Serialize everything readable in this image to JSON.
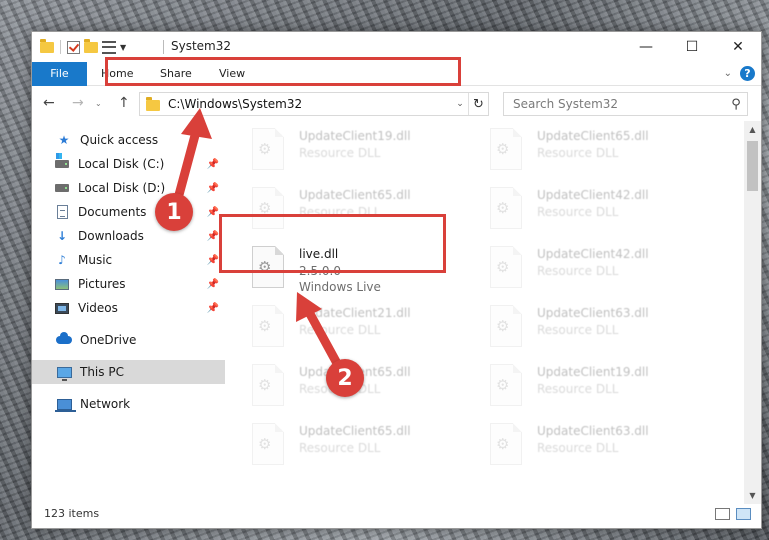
{
  "window": {
    "title": "System32",
    "controls": {
      "minimize": "—",
      "maximize": "☐",
      "close": "✕"
    }
  },
  "ribbon": {
    "tabs": [
      "File",
      "Home",
      "Share",
      "View"
    ],
    "collapse_glyph": "⌄",
    "help_glyph": "?"
  },
  "address_bar": {
    "path": "C:\\Windows\\System32",
    "dropdown_glyph": "⌄",
    "refresh_glyph": "↻"
  },
  "search": {
    "placeholder": "Search System32",
    "icon_glyph": "⚲"
  },
  "nav_buttons": {
    "back": "←",
    "forward": "→",
    "recent": "⌄",
    "up": "↑"
  },
  "sidebar": {
    "items": [
      {
        "label": "Quick access",
        "icon": "star-icon",
        "pinned": false
      },
      {
        "label": "Local Disk (C:)",
        "icon": "drive-icon",
        "pinned": true
      },
      {
        "label": "Local Disk (D:)",
        "icon": "drive-icon",
        "pinned": true
      },
      {
        "label": "Documents",
        "icon": "documents-icon",
        "pinned": true
      },
      {
        "label": "Downloads",
        "icon": "downloads-icon",
        "pinned": true
      },
      {
        "label": "Music",
        "icon": "music-icon",
        "pinned": true
      },
      {
        "label": "Pictures",
        "icon": "pictures-icon",
        "pinned": true
      },
      {
        "label": "Videos",
        "icon": "videos-icon",
        "pinned": true
      },
      {
        "label": "OneDrive",
        "icon": "onedrive-icon",
        "pinned": false
      },
      {
        "label": "This PC",
        "icon": "this-pc-icon",
        "pinned": false,
        "selected": true
      },
      {
        "label": "Network",
        "icon": "network-icon",
        "pinned": false
      }
    ],
    "pin_glyph": "📌"
  },
  "files": [
    {
      "name": "UpdateClient19.dll",
      "desc": "Resource DLL",
      "faded": true
    },
    {
      "name": "UpdateClient65.dll",
      "desc": "Resource DLL",
      "faded": true
    },
    {
      "name": "UpdateClient65.dll",
      "desc": "Resource DLL",
      "faded": true
    },
    {
      "name": "UpdateClient42.dll",
      "desc": "Resource DLL",
      "faded": true
    },
    {
      "name": "live.dll",
      "version": "2.5.0.0",
      "company": "Windows Live",
      "faded": false
    },
    {
      "name": "UpdateClient42.dll",
      "desc": "Resource DLL",
      "faded": true
    },
    {
      "name": "UpdateClient21.dll",
      "desc": "Resource DLL",
      "faded": true
    },
    {
      "name": "UpdateClient63.dll",
      "desc": "Resource DLL",
      "faded": true
    },
    {
      "name": "UpdateClient65.dll",
      "desc": "Resource DLL",
      "faded": true
    },
    {
      "name": "UpdateClient19.dll",
      "desc": "Resource DLL",
      "faded": true
    },
    {
      "name": "UpdateClient65.dll",
      "desc": "Resource DLL",
      "faded": true
    },
    {
      "name": "UpdateClient63.dll",
      "desc": "Resource DLL",
      "faded": true
    }
  ],
  "status": {
    "item_count": "123 items"
  },
  "annotations": {
    "step1": "1",
    "step2": "2",
    "color": "#d9403a"
  },
  "colors": {
    "accent": "#1979ca",
    "highlight": "#d9403a",
    "selected_nav": "#d9d9d9"
  }
}
